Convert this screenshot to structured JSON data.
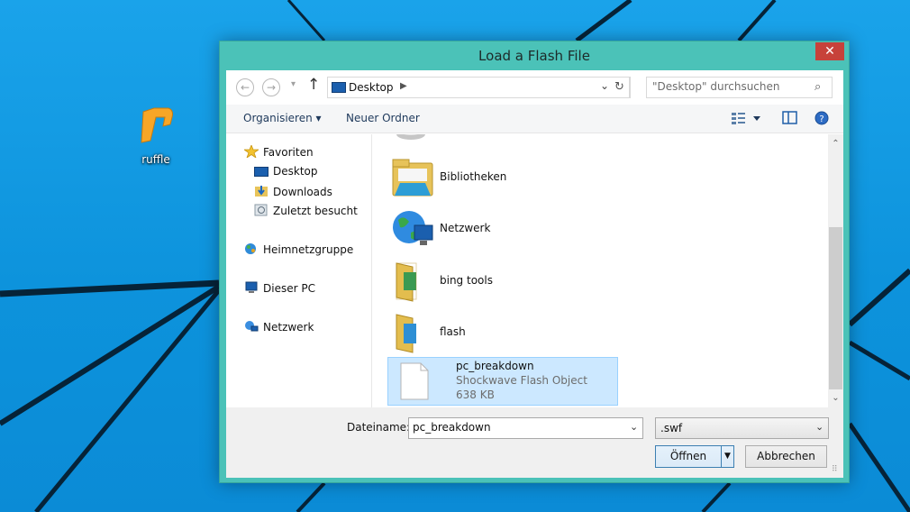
{
  "desktop": {
    "icon_label": "ruffle",
    "accent_color": "#0f9be3"
  },
  "dialog": {
    "title": "Load a Flash File",
    "close_glyph": "✕",
    "frame_color": "#4bc2b8"
  },
  "navigation": {
    "back_icon": "back-arrow-icon",
    "forward_icon": "forward-arrow-icon",
    "up_icon": "up-arrow-icon",
    "address": "Desktop",
    "search_placeholder": "\"Desktop\" durchsuchen"
  },
  "toolbar": {
    "organize_label": "Organisieren ▾",
    "new_folder_label": "Neuer Ordner"
  },
  "nav_pane": {
    "favorites_label": "Favoriten",
    "favorites": [
      {
        "label": "Desktop",
        "icon": "desktop-icon"
      },
      {
        "label": "Downloads",
        "icon": "downloads-icon"
      },
      {
        "label": "Zuletzt besucht",
        "icon": "recent-places-icon"
      }
    ],
    "homegroup_label": "Heimnetzgruppe",
    "this_pc_label": "Dieser PC",
    "network_label": "Netzwerk"
  },
  "files": [
    {
      "name": "Bibliotheken",
      "icon": "libraries-icon"
    },
    {
      "name": "Netzwerk",
      "icon": "network-globe-icon"
    },
    {
      "name": "bing tools",
      "icon": "folder-icon"
    },
    {
      "name": "flash",
      "icon": "folder-icon"
    }
  ],
  "selected_file": {
    "name": "pc_breakdown",
    "type": "Shockwave Flash Object",
    "size": "638 KB"
  },
  "bottom": {
    "filename_label": "Dateiname:",
    "filename_value": "pc_breakdown",
    "filetype_value": ".swf",
    "open_label": "Öffnen",
    "cancel_label": "Abbrechen"
  }
}
